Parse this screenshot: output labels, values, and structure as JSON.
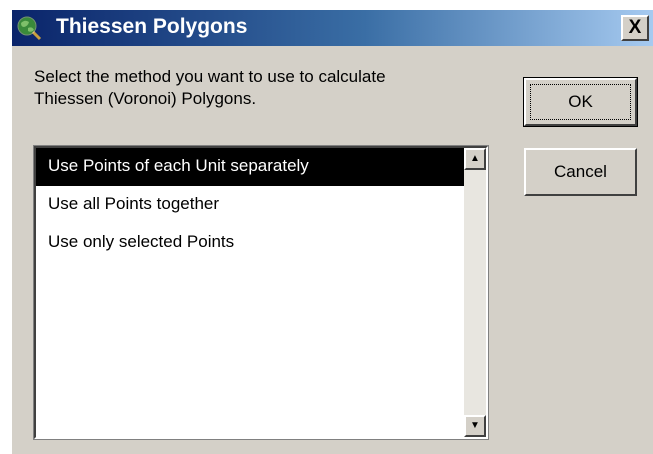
{
  "window": {
    "title": "Thiessen Polygons",
    "close_label": "X"
  },
  "prompt": {
    "line1": "Select the method you want to use to calculate",
    "line2": "Thiessen (Voronoi) Polygons."
  },
  "buttons": {
    "ok_label": "OK",
    "cancel_label": "Cancel"
  },
  "method_list": {
    "items": [
      {
        "label": "Use Points of each Unit separately",
        "selected": true
      },
      {
        "label": "Use all Points together",
        "selected": false
      },
      {
        "label": "Use only selected Points",
        "selected": false
      }
    ]
  },
  "scrollbar": {
    "up_glyph": "▲",
    "down_glyph": "▼"
  },
  "icons": {
    "title": "globe-magnifier-icon"
  },
  "colors": {
    "titlebar_start": "#0a246a",
    "titlebar_end": "#a6caf0",
    "selection_bg": "#000000",
    "selection_fg": "#ffffff",
    "face": "#d4d0c8"
  }
}
